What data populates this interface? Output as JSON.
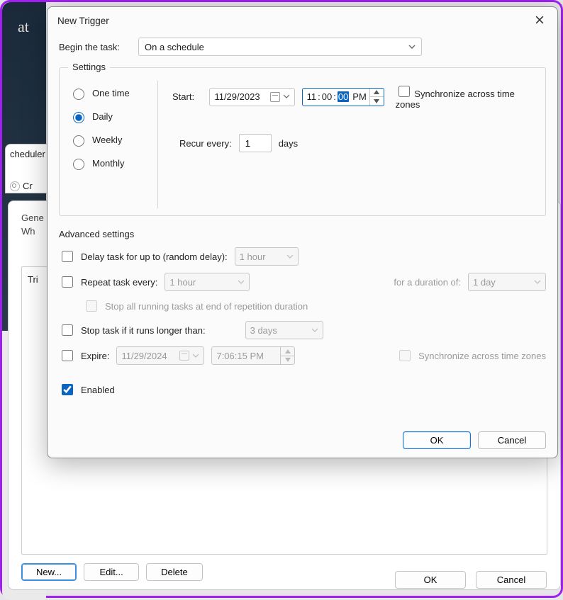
{
  "dialog": {
    "title": "New Trigger",
    "begin": {
      "label": "Begin the task:",
      "value": "On a schedule"
    },
    "settings": {
      "legend": "Settings",
      "options": {
        "one_time": "One time",
        "daily": "Daily",
        "weekly": "Weekly",
        "monthly": "Monthly"
      },
      "selected": "daily",
      "start_label": "Start:",
      "start_date": "11/29/2023",
      "start_time": {
        "hour": "11",
        "min": "00",
        "sec": "00",
        "ampm": "PM"
      },
      "sync_label": "Synchronize across time zones",
      "recur_label": "Recur every:",
      "recur_value": "1",
      "recur_unit": "days"
    },
    "advanced": {
      "legend": "Advanced settings",
      "delay_label": "Delay task for up to (random delay):",
      "delay_value": "1 hour",
      "repeat_label": "Repeat task every:",
      "repeat_value": "1 hour",
      "duration_label": "for a duration of:",
      "duration_value": "1 day",
      "stop_all_label": "Stop all running tasks at end of repetition duration",
      "stop_if_label": "Stop task if it runs longer than:",
      "stop_if_value": "3 days",
      "expire_label": "Expire:",
      "expire_date": "11/29/2024",
      "expire_time": "7:06:15 PM",
      "expire_sync_label": "Synchronize across time zones",
      "enabled_label": "Enabled"
    },
    "buttons": {
      "ok": "OK",
      "cancel": "Cancel"
    }
  },
  "background": {
    "scheduler_fragment": "cheduler",
    "create_fragment": "Cr",
    "tabs": {
      "general": "Gene",
      "when": "Wh"
    },
    "panel_fragment": "Tri",
    "buttons": {
      "new": "New...",
      "edit": "Edit...",
      "delete": "Delete"
    },
    "footer": {
      "ok": "OK",
      "cancel": "Cancel"
    },
    "strip_text": "at"
  }
}
